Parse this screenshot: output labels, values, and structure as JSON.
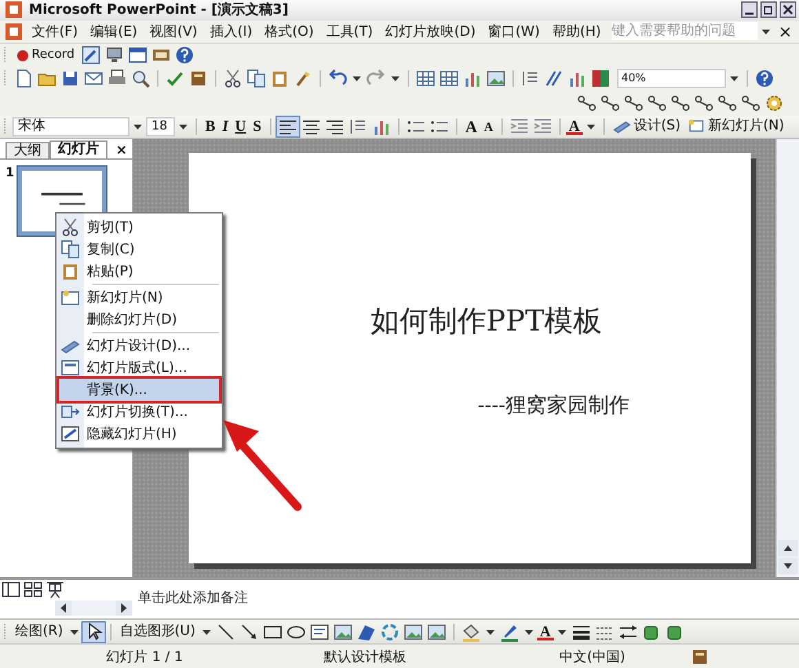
{
  "window": {
    "title": "Microsoft PowerPoint - [演示文稿3]"
  },
  "menu_bar": {
    "items": [
      "文件(F)",
      "编辑(E)",
      "视图(V)",
      "插入(I)",
      "格式(O)",
      "工具(T)",
      "幻灯片放映(D)",
      "窗口(W)",
      "帮助(H)"
    ],
    "help_placeholder": "键入需要帮助的问题",
    "close": "×"
  },
  "record_toolbar": {
    "label": "Record"
  },
  "standard_toolbar": {
    "zoom": "40%"
  },
  "formatting_toolbar": {
    "font": "宋体",
    "size": "18",
    "bold": "B",
    "italic": "I",
    "underline": "U",
    "shadow": "S",
    "grow_font": "A",
    "shrink_font": "A",
    "font_color": "A",
    "design": "设计(S)",
    "new_slide": "新幻灯片(N)"
  },
  "pane_tabs": [
    {
      "label": "大纲",
      "selected": false
    },
    {
      "label": "幻灯片",
      "selected": true
    }
  ],
  "pane_close": "×",
  "thumbnails": [
    {
      "number": "1",
      "selected": true
    }
  ],
  "context_menu": {
    "items": [
      {
        "label": "剪切(T)",
        "divider_above": false,
        "selected": false
      },
      {
        "label": "复制(C)",
        "divider_above": false,
        "selected": false
      },
      {
        "label": "粘贴(P)",
        "divider_above": false,
        "selected": false
      },
      {
        "label": "新幻灯片(N)",
        "divider_above": true,
        "selected": false
      },
      {
        "label": "删除幻灯片(D)",
        "divider_above": false,
        "selected": false
      },
      {
        "label": "幻灯片设计(D)...",
        "divider_above": true,
        "selected": false
      },
      {
        "label": "幻灯片版式(L)...",
        "divider_above": false,
        "selected": false
      },
      {
        "label": "背景(K)...",
        "divider_above": false,
        "selected": true
      },
      {
        "label": "幻灯片切换(T)...",
        "divider_above": false,
        "selected": false
      },
      {
        "label": "隐藏幻灯片(H)",
        "divider_above": false,
        "selected": false
      }
    ]
  },
  "slide": {
    "title": "如何制作PPT模板",
    "subtitle": "----狸窝家园制作"
  },
  "notes": {
    "placeholder": "单击此处添加备注"
  },
  "drawing_toolbar": {
    "draw": "绘图(R)",
    "autoshapes": "自选图形(U)",
    "font_color": "A"
  },
  "status_bar": [
    "幻灯片 1 / 1",
    "默认设计模板",
    "中文(中国)"
  ]
}
